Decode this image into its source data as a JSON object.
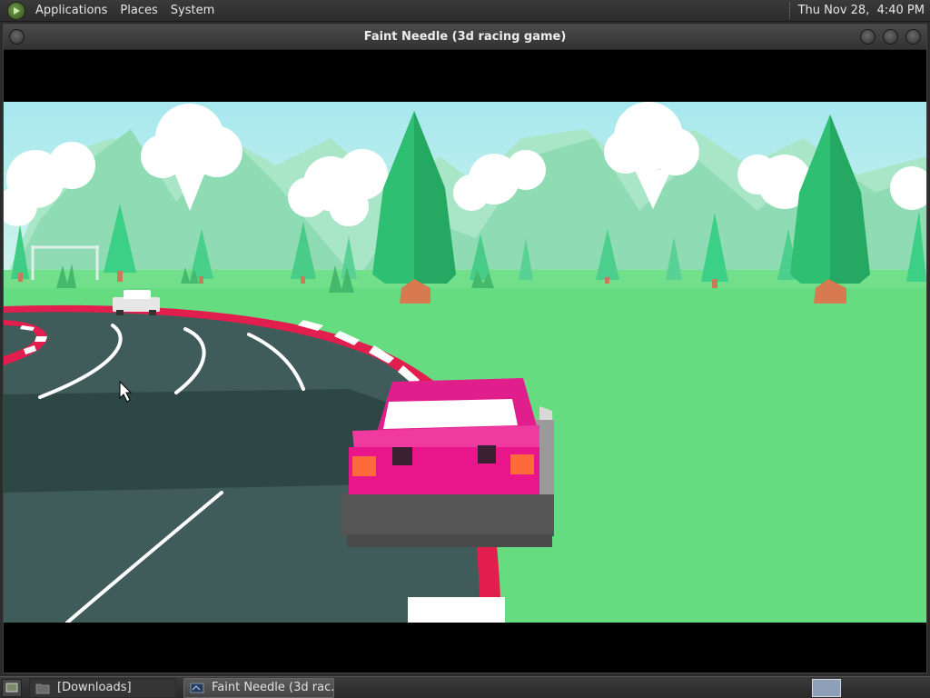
{
  "top_panel": {
    "menus": [
      "Applications",
      "Places",
      "System"
    ],
    "clock": "Thu Nov 28,  4:40 PM"
  },
  "window": {
    "title": "Faint Needle (3d racing game)"
  },
  "taskbar": {
    "tasks": [
      "[Downloads]",
      "Faint Needle (3d rac..."
    ]
  },
  "colors": {
    "sky": "#bfeef0",
    "grass": "#66dc80",
    "road": "#405c5a",
    "player_car": "#e01e8c",
    "kerb_red": "#e21e4e"
  }
}
